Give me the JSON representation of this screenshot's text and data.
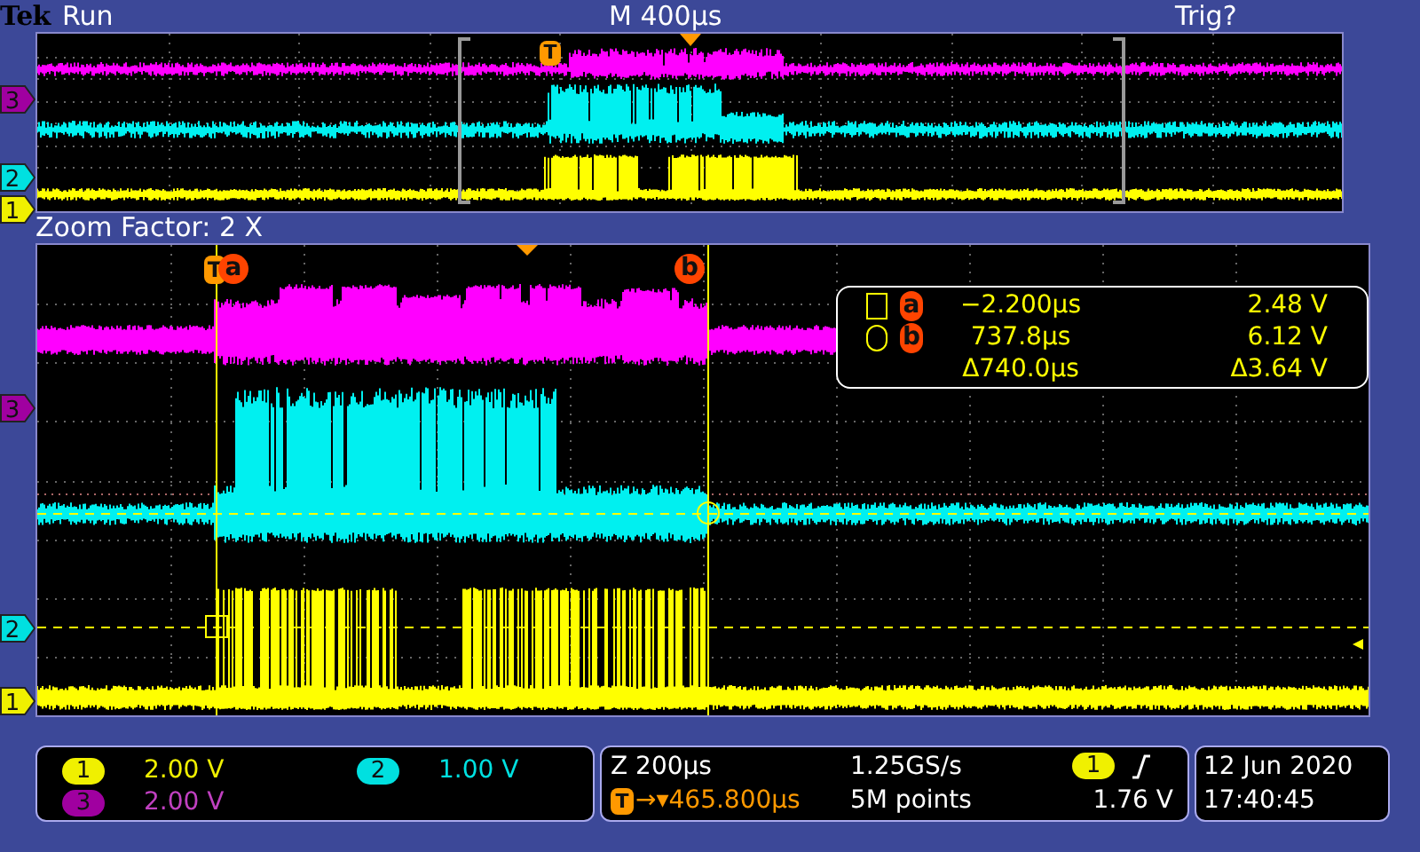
{
  "header": {
    "brand": "Tek",
    "state": "Run",
    "timebase": "M 400µs",
    "trigger_status": "Trig?"
  },
  "overview": {
    "trigger_marker": "T",
    "channel_markers": [
      {
        "label": "3",
        "color": "#a000a0"
      },
      {
        "label": "2",
        "color": "#00e0e0"
      },
      {
        "label": "1",
        "color": "#f0f000"
      }
    ]
  },
  "zoom_factor": "Zoom Factor: 2 X",
  "main": {
    "trigger_marker": "T",
    "cursors": [
      {
        "label": "a"
      },
      {
        "label": "b"
      }
    ],
    "channel_markers": [
      {
        "label": "3",
        "color": "#a000a0"
      },
      {
        "label": "2",
        "color": "#00e0e0"
      },
      {
        "label": "1",
        "color": "#f0f000"
      }
    ]
  },
  "cursor_readout": {
    "rows": [
      {
        "kind": "square",
        "label": "a",
        "time": "−2.200µs",
        "voltage": "2.48 V"
      },
      {
        "kind": "circle",
        "label": "b",
        "time": "737.8µs",
        "voltage": "6.12 V"
      },
      {
        "kind": "delta",
        "time": "Δ740.0µs",
        "voltage": "Δ3.64 V"
      }
    ]
  },
  "channels": [
    {
      "label": "1",
      "scale": "2.00 V",
      "color": "#f0f000"
    },
    {
      "label": "2",
      "scale": "1.00 V",
      "color": "#00e0e0"
    },
    {
      "label": "3",
      "scale": "2.00 V",
      "color": "#a000a0"
    }
  ],
  "acquisition": {
    "zoom": "Z 200µs",
    "sample_rate": "1.25GS/s",
    "trigger_icon": "T",
    "position": "→▾465.800µs",
    "record_length": "5M points",
    "trigger_source": "1",
    "trigger_level": "1.76 V"
  },
  "datetime": {
    "date": "12 Jun 2020",
    "time": "17:40:45"
  }
}
